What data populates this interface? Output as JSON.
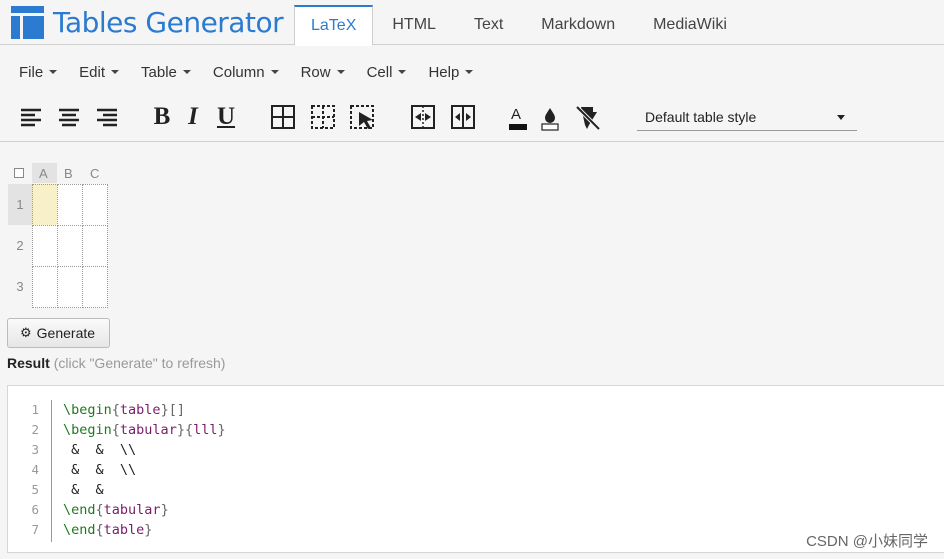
{
  "app": {
    "name": "Tables Generator"
  },
  "tabs": [
    {
      "label": "LaTeX",
      "active": true
    },
    {
      "label": "HTML",
      "active": false
    },
    {
      "label": "Text",
      "active": false
    },
    {
      "label": "Markdown",
      "active": false
    },
    {
      "label": "MediaWiki",
      "active": false
    }
  ],
  "menu": [
    "File",
    "Edit",
    "Table",
    "Column",
    "Row",
    "Cell",
    "Help"
  ],
  "toolbar": {
    "bold": "B",
    "italic": "I",
    "underline": "U",
    "text_color_letter": "A",
    "style_select": "Default table style",
    "icons": [
      "align-left-icon",
      "align-center-icon",
      "align-right-icon",
      "bold-icon",
      "italic-icon",
      "underline-icon",
      "all-borders-icon",
      "no-borders-icon",
      "border-select-icon",
      "merge-cells-icon",
      "split-cells-icon",
      "text-color-icon",
      "background-color-icon",
      "clear-format-icon"
    ]
  },
  "grid": {
    "columns": [
      "A",
      "B",
      "C"
    ],
    "rows": [
      "1",
      "2",
      "3"
    ],
    "selected": {
      "row": "1",
      "col": "A"
    }
  },
  "generate_button": "Generate",
  "result": {
    "label": "Result",
    "hint": "(click \"Generate\" to refresh)"
  },
  "code": {
    "line_numbers": [
      "1",
      "2",
      "3",
      "4",
      "5",
      "6",
      "7"
    ],
    "lines": [
      [
        [
          "k",
          "\\begin"
        ],
        [
          "b",
          "{"
        ],
        [
          "a",
          "table"
        ],
        [
          "b",
          "}[]"
        ]
      ],
      [
        [
          "k",
          "\\begin"
        ],
        [
          "b",
          "{"
        ],
        [
          "a",
          "tabular"
        ],
        [
          "b",
          "}{"
        ],
        [
          "a",
          "lll"
        ],
        [
          "b",
          "}"
        ]
      ],
      [
        [
          "t",
          " &  &  \\\\"
        ]
      ],
      [
        [
          "t",
          " &  &  \\\\"
        ]
      ],
      [
        [
          "t",
          " &  &"
        ]
      ],
      [
        [
          "k",
          "\\end"
        ],
        [
          "b",
          "{"
        ],
        [
          "a",
          "tabular"
        ],
        [
          "b",
          "}"
        ]
      ],
      [
        [
          "k",
          "\\end"
        ],
        [
          "b",
          "{"
        ],
        [
          "a",
          "table"
        ],
        [
          "b",
          "}"
        ]
      ]
    ]
  },
  "watermark": "CSDN @小妹同学",
  "colors": {
    "brand": "#2b7bd1",
    "selected_cell": "#f7f0c8"
  }
}
